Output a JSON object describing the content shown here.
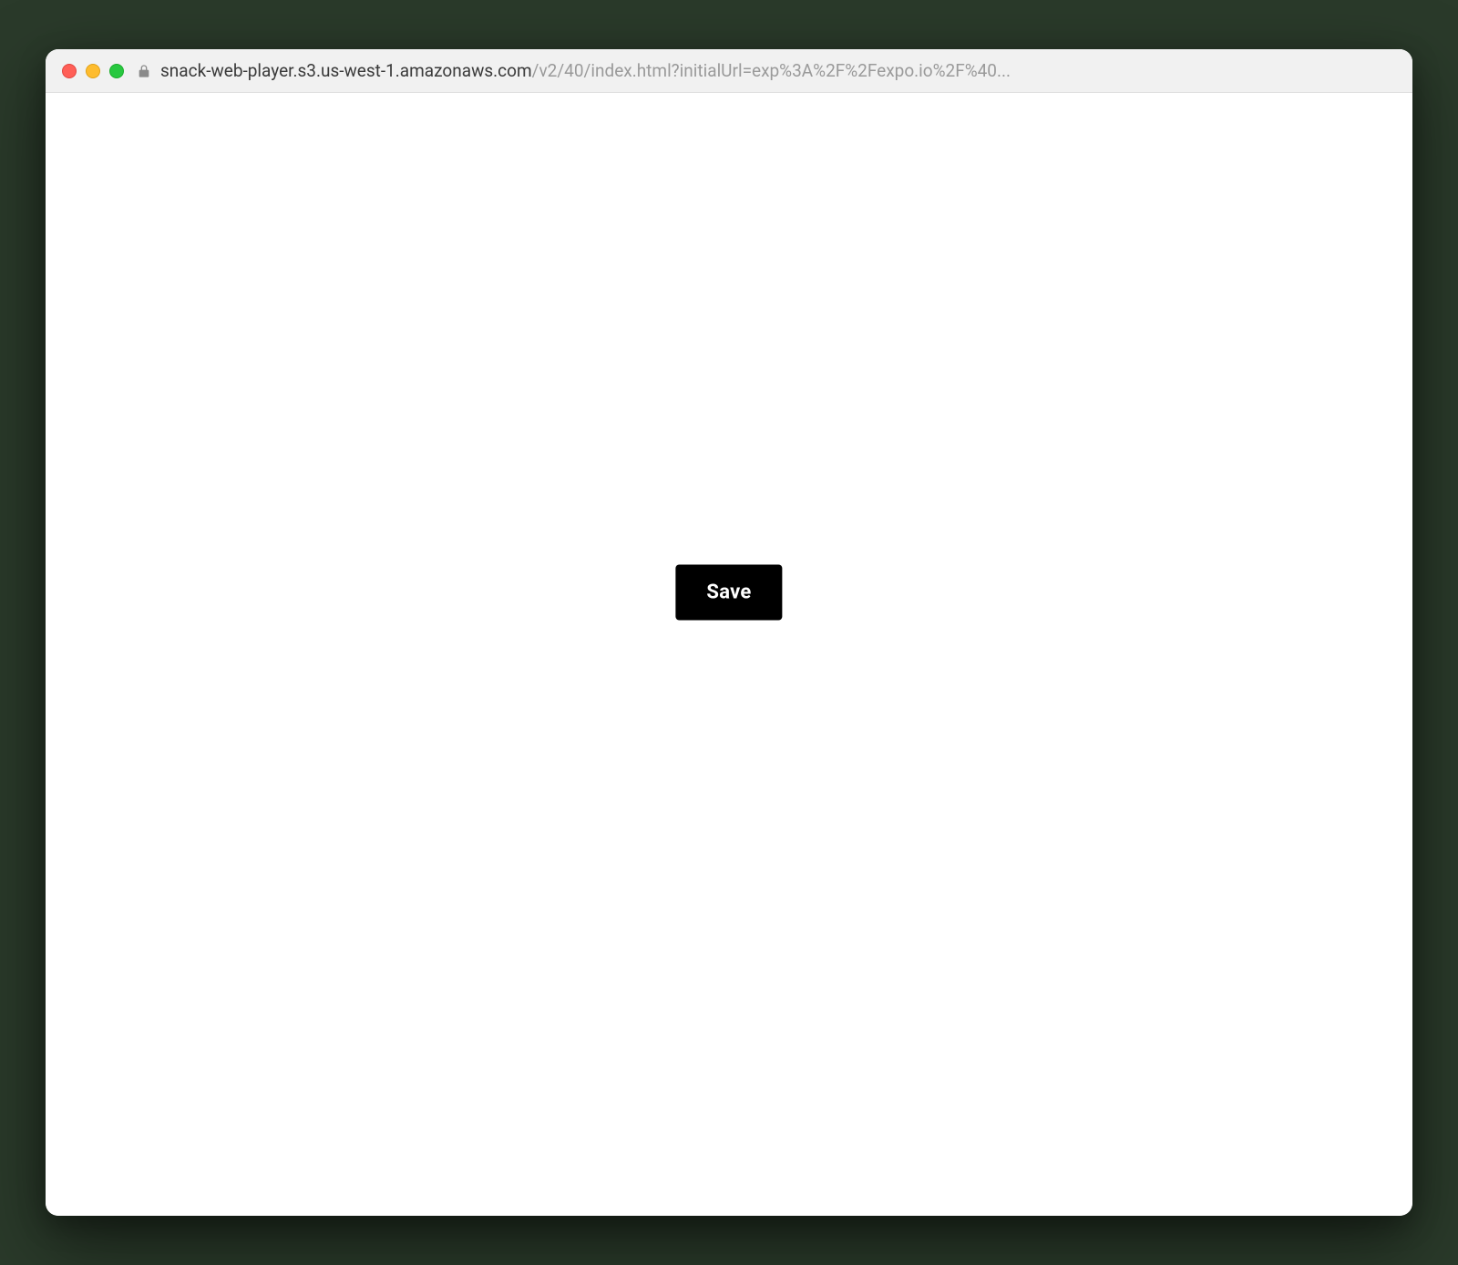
{
  "browser": {
    "url_host": "snack-web-player.s3.us-west-1.amazonaws.com",
    "url_rest": "/v2/40/index.html?initialUrl=exp%3A%2F%2Fexpo.io%2F%40..."
  },
  "main": {
    "save_label": "Save"
  },
  "colors": {
    "button_bg": "#000000",
    "button_fg": "#ffffff"
  }
}
